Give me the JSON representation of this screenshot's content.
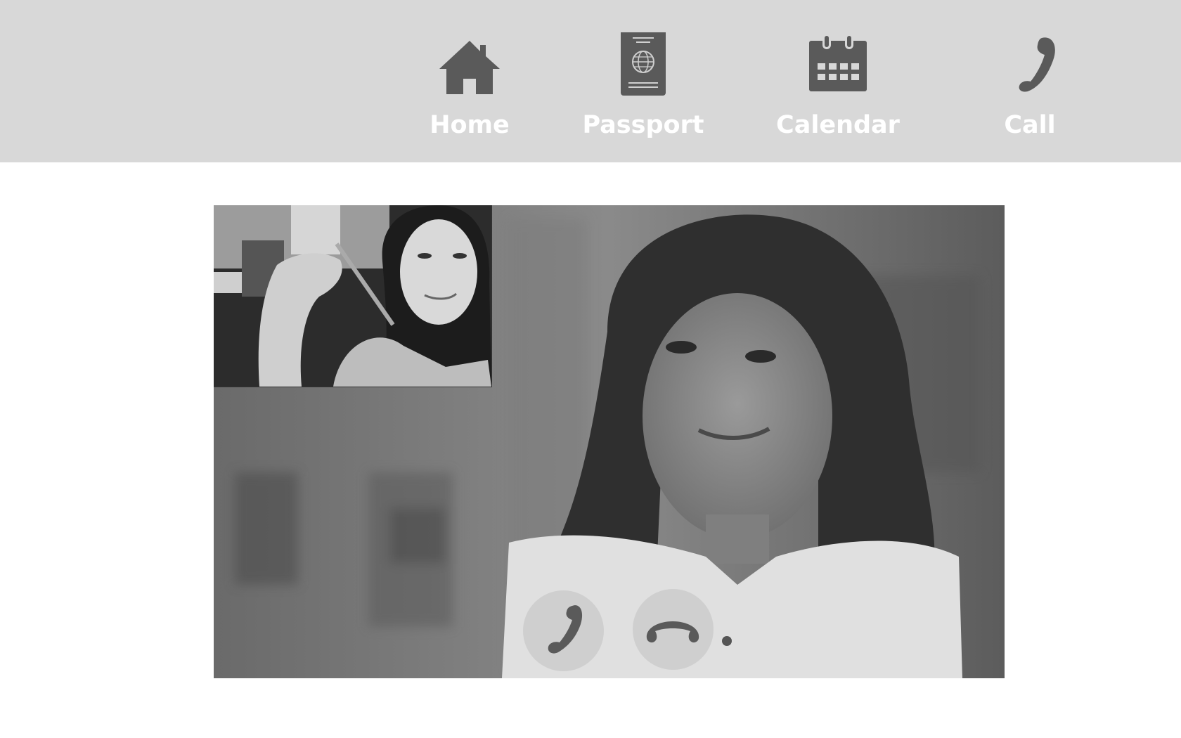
{
  "nav": {
    "items": [
      {
        "id": "home",
        "label": "Home",
        "icon": "house-icon"
      },
      {
        "id": "passport",
        "label": "Passport",
        "icon": "passport-icon"
      },
      {
        "id": "calendar",
        "label": "Calendar",
        "icon": "calendar-icon"
      },
      {
        "id": "call",
        "label": "Call",
        "icon": "phone-icon"
      }
    ]
  },
  "colors": {
    "topbar_bg": "#d8d8d8",
    "icon": "#5a5a5a",
    "label": "#ffffff",
    "call_button_bg": "#cfcfcf"
  },
  "video_call": {
    "remote_video": "remote-participant-video",
    "self_view": "self-view-video",
    "controls": [
      {
        "id": "answer",
        "icon": "phone-answer-icon"
      },
      {
        "id": "hangup",
        "icon": "phone-hangup-icon"
      }
    ]
  }
}
